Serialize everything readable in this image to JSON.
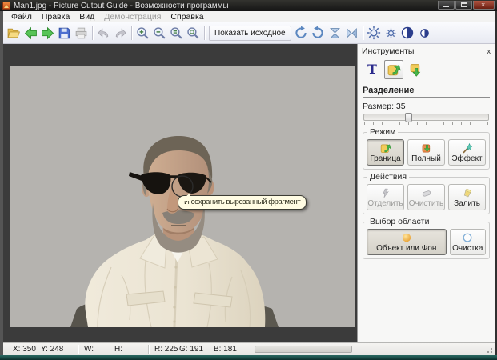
{
  "titlebar": {
    "title": "Man1.jpg - Picture Cutout Guide - Возможности программы"
  },
  "menu": {
    "items": [
      "Файл",
      "Правка",
      "Вид",
      "Демонстрация",
      "Справка"
    ]
  },
  "toolbar": {
    "show_original": "Показать исходное",
    "icons": [
      "open-icon",
      "back-icon",
      "forward-icon",
      "save-icon",
      "print-icon",
      "undo-icon",
      "redo-icon",
      "zoom-in-icon",
      "zoom-out-icon",
      "zoom-100-icon",
      "zoom-fit-icon",
      "rotate-cw-icon",
      "rotate-ccw-icon",
      "flip-vertical-icon",
      "flip-horizontal-icon",
      "brightness-icon",
      "brightness-small-icon",
      "contrast-icon",
      "contrast-small-icon"
    ]
  },
  "canvas": {
    "tooltip": "И сохранить вырезанный фрагмент"
  },
  "panel": {
    "title": "Инструменты",
    "close": "x",
    "text_tool": "T",
    "separation": {
      "title": "Разделение",
      "size_label": "Размер: 35",
      "size_value": 35
    },
    "mode": {
      "title": "Режим",
      "buttons": [
        "Граница",
        "Полный",
        "Эффект"
      ]
    },
    "actions": {
      "title": "Действия",
      "buttons": [
        "Отделить",
        "Очистить",
        "Залить"
      ]
    },
    "selection": {
      "title": "Выбор области",
      "buttons": [
        "Объект или Фон",
        "Очистка"
      ]
    }
  },
  "statusbar": {
    "x": "X: 350",
    "y": "Y: 248",
    "w": "W:",
    "h": "H:",
    "r": "R: 225",
    "g": "G: 191",
    "b": "B: 181"
  },
  "colors": {
    "canvas_bg": "#3b3b3b",
    "photo_bg": "#b5b3af",
    "tooltip_bg": "#fffce3",
    "accent_green": "#4ab54a",
    "accent_yellow": "#f2cc5a",
    "teal_strip": "#174a44"
  }
}
